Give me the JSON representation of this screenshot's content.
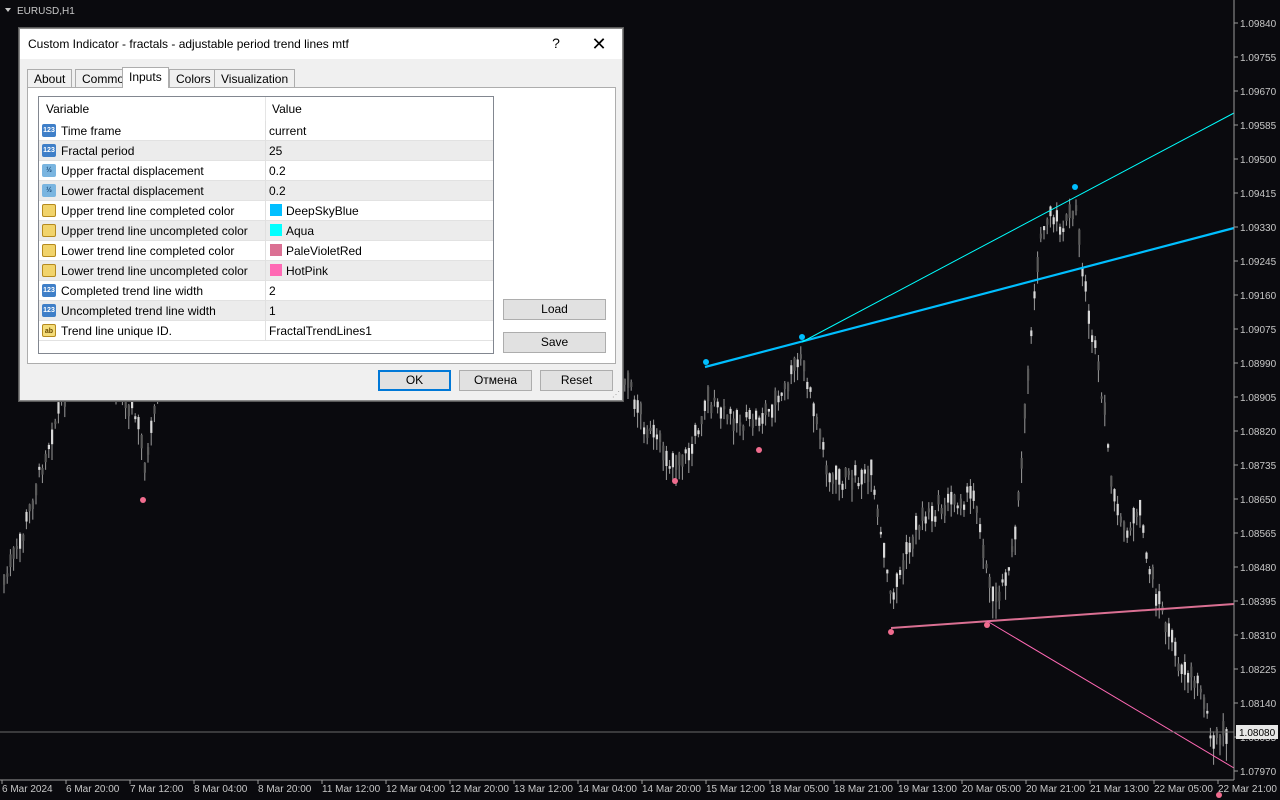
{
  "chart": {
    "symbol_label": "EURUSD,H1",
    "price_axis": [
      "1.09840",
      "1.09755",
      "1.09670",
      "1.09585",
      "1.09500",
      "1.09415",
      "1.09330",
      "1.09245",
      "1.09160",
      "1.09075",
      "1.08990",
      "1.08905",
      "1.08820",
      "1.08735",
      "1.08650",
      "1.08565",
      "1.08480",
      "1.08395",
      "1.08310",
      "1.08225",
      "1.08140",
      "1.08055",
      "1.07970"
    ],
    "current_price": "1.08080",
    "time_axis": [
      "6 Mar 2024",
      "6 Mar 20:00",
      "7 Mar 12:00",
      "8 Mar 04:00",
      "8 Mar 20:00",
      "11 Mar 12:00",
      "12 Mar 04:00",
      "12 Mar 20:00",
      "13 Mar 12:00",
      "14 Mar 04:00",
      "14 Mar 20:00",
      "15 Mar 12:00",
      "18 Mar 05:00",
      "18 Mar 21:00",
      "19 Mar 13:00",
      "20 Mar 05:00",
      "20 Mar 21:00",
      "21 Mar 13:00",
      "22 Mar 05:00",
      "22 Mar 21:00"
    ],
    "colors": {
      "background": "#0a0a0e",
      "candle": "#d0d0d0",
      "upper_completed": "#00BFFF",
      "upper_uncompleted": "#00FFFF",
      "lower_completed": "#DB7093",
      "lower_uncompleted": "#FF69B4"
    }
  },
  "dialog": {
    "title": "Custom Indicator - fractals - adjustable period trend lines mtf",
    "help_label": "?",
    "close_label": "✕",
    "tabs": [
      "About",
      "Common",
      "Inputs",
      "Colors",
      "Visualization"
    ],
    "active_tab": "Inputs",
    "grid_headers": {
      "variable": "Variable",
      "value": "Value"
    },
    "params": [
      {
        "type": "int",
        "icon": "123",
        "name": "Time frame",
        "value": "current"
      },
      {
        "type": "int",
        "icon": "123",
        "name": "Fractal period",
        "value": "25"
      },
      {
        "type": "double",
        "icon": "½",
        "name": "Upper fractal displacement",
        "value": "0.2"
      },
      {
        "type": "double",
        "icon": "½",
        "name": "Lower fractal displacement",
        "value": "0.2"
      },
      {
        "type": "color",
        "icon": "",
        "name": "Upper trend line completed color",
        "value": "DeepSkyBlue",
        "swatch": "#00BFFF"
      },
      {
        "type": "color",
        "icon": "",
        "name": "Upper trend line uncompleted color",
        "value": "Aqua",
        "swatch": "#00FFFF"
      },
      {
        "type": "color",
        "icon": "",
        "name": "Lower trend line completed color",
        "value": "PaleVioletRed",
        "swatch": "#DB7093"
      },
      {
        "type": "color",
        "icon": "",
        "name": "Lower trend line uncompleted color",
        "value": "HotPink",
        "swatch": "#FF69B4"
      },
      {
        "type": "int",
        "icon": "123",
        "name": "Completed trend line width",
        "value": "2"
      },
      {
        "type": "int",
        "icon": "123",
        "name": "Uncompleted trend line width",
        "value": "1"
      },
      {
        "type": "string",
        "icon": "ab",
        "name": "Trend line unique ID.",
        "value": "FractalTrendLines1"
      }
    ],
    "buttons": {
      "load": "Load",
      "save": "Save",
      "ok": "OK",
      "cancel": "Отмена",
      "reset": "Reset"
    }
  }
}
